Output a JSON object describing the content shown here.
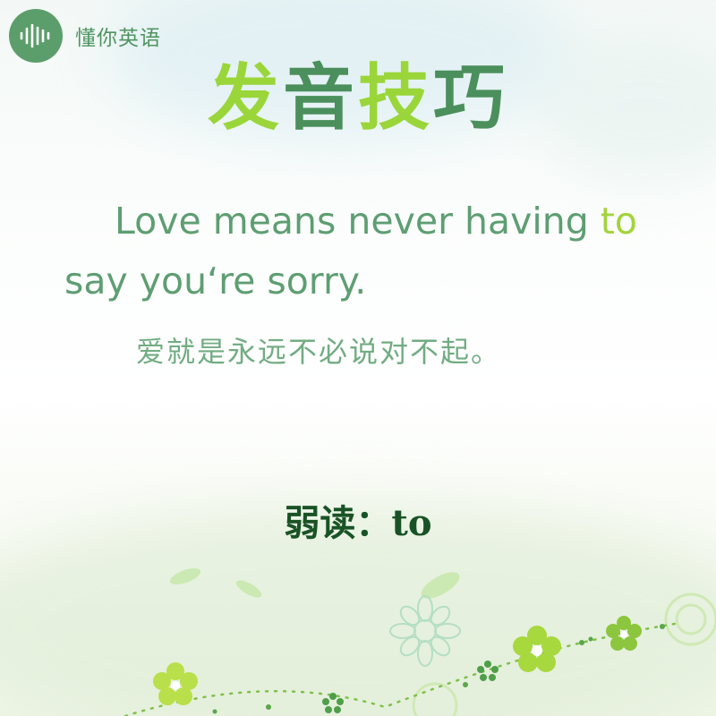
{
  "brand": {
    "name": "懂你英语",
    "icon": "sound-wave-icon",
    "color": "#5c9e6b"
  },
  "title": {
    "chars": [
      "发",
      "音",
      "技",
      "巧"
    ],
    "colors": [
      "#9ad63a",
      "#4b8f5c"
    ]
  },
  "sentence": {
    "before": "Love means never having ",
    "highlight": "to",
    "after": " say you‘re sorry.",
    "text_color": "#5e9e72",
    "highlight_color": "#a4d33d"
  },
  "translation": "爱就是永远不必说对不起。",
  "weak_reading": {
    "label": "弱读：",
    "word": "to"
  }
}
